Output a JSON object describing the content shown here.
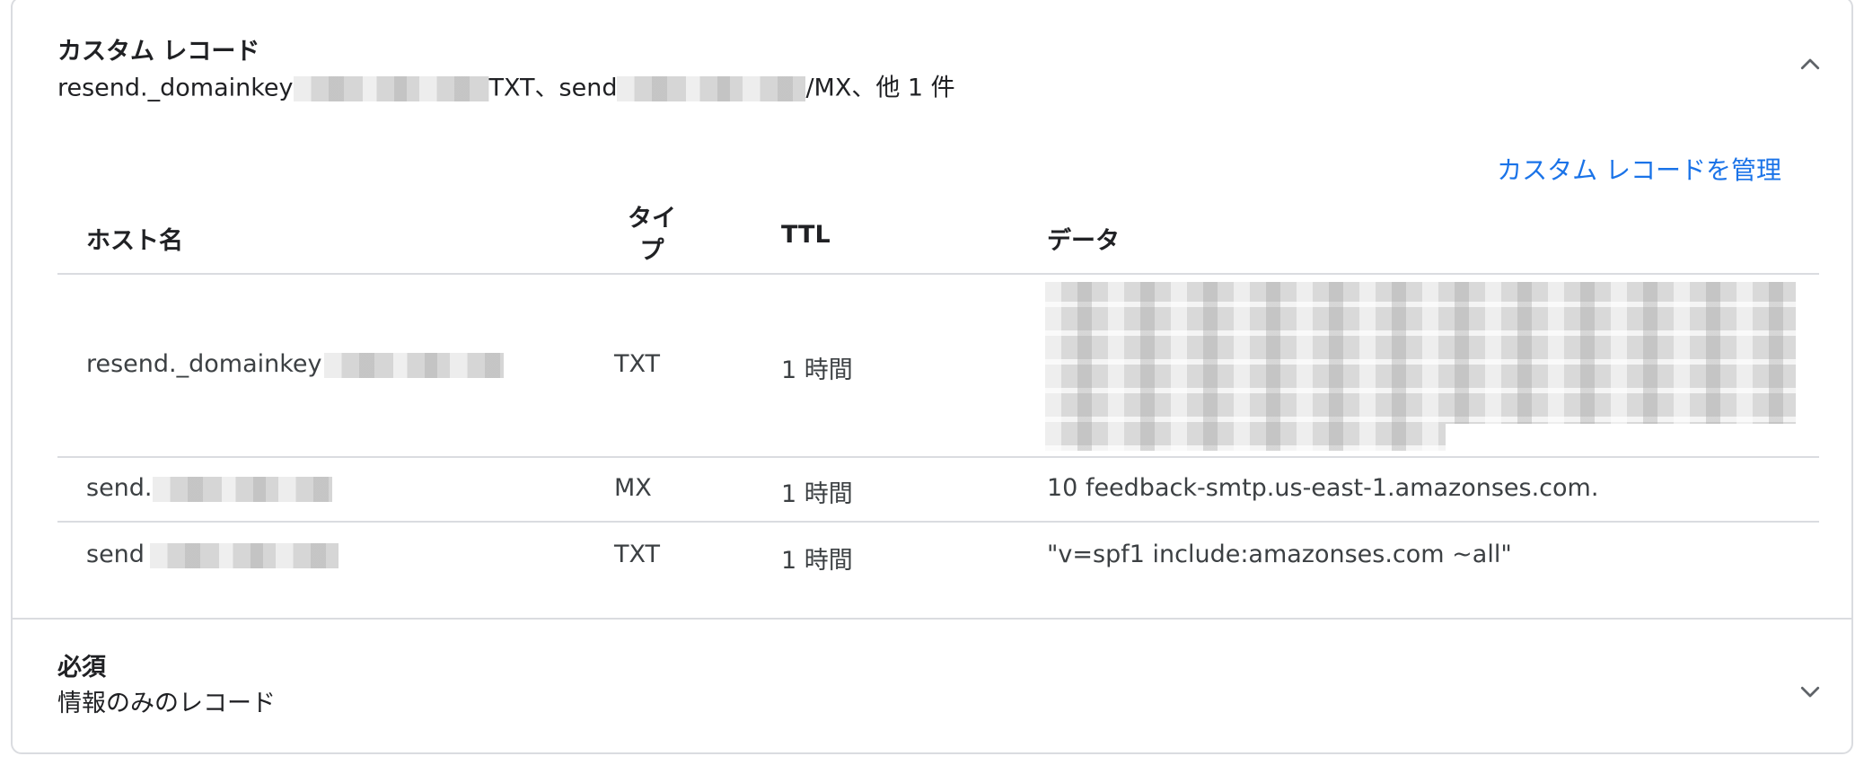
{
  "custom_records": {
    "title": "カスタム レコード",
    "summary_part1": "resend._domainkey",
    "summary_part2": "TXT、send",
    "summary_part3": "/MX、他 1 件",
    "manage_link": "カスタム レコードを管理",
    "expanded_icon": "chevron-up-icon"
  },
  "table": {
    "headers": {
      "host": "ホスト名",
      "type": "タイプ",
      "ttl": "TTL",
      "data": "データ"
    },
    "rows": [
      {
        "host": "resend._domainkey",
        "type": "TXT",
        "ttl": "1 時間",
        "data": ""
      },
      {
        "host": "send.",
        "type": "MX",
        "ttl": "1 時間",
        "data": "10 feedback-smtp.us-east-1.amazonses.com."
      },
      {
        "host": "send",
        "type": "TXT",
        "ttl": "1 時間",
        "data": "\"v=spf1 include:amazonses.com ~all\""
      }
    ]
  },
  "required": {
    "title": "必須",
    "subtitle": "情報のみのレコード",
    "collapsed_icon": "chevron-down-icon"
  },
  "colors": {
    "link": "#1a73e8",
    "border": "#dadce0",
    "text": "#202124"
  }
}
